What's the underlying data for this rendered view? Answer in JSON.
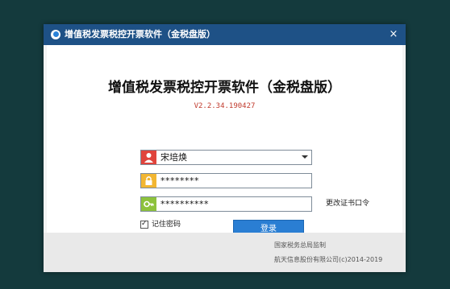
{
  "window": {
    "title": "增值税发票税控开票软件（金税盘版）",
    "close_label": "×"
  },
  "main": {
    "heading": "增值税发票税控开票软件（金税盘版）",
    "version": "V2.2.34.190427"
  },
  "login": {
    "user_value": "宋培焕",
    "password_value": "********",
    "cert_password_value": "**********",
    "change_cert_password_label": "更改证书口令",
    "remember_label": "记住密码",
    "remember_checked": true,
    "login_button_label": "登录"
  },
  "footer": {
    "line1": "国家税务总局监制",
    "line2": "航天信息股份有限公司(c)2014-2019"
  },
  "colors": {
    "titlebar": "#1e5186",
    "user_icon": "#e0443c",
    "lock_icon": "#f2b632",
    "key_icon": "#8dc23c",
    "login_button": "#2a7ed3",
    "version_text": "#c0392b"
  },
  "icons": {
    "app": "app-logo-icon",
    "user": "user-icon",
    "lock": "lock-icon",
    "key": "key-icon",
    "dropdown": "chevron-down-icon",
    "close": "close-icon"
  }
}
